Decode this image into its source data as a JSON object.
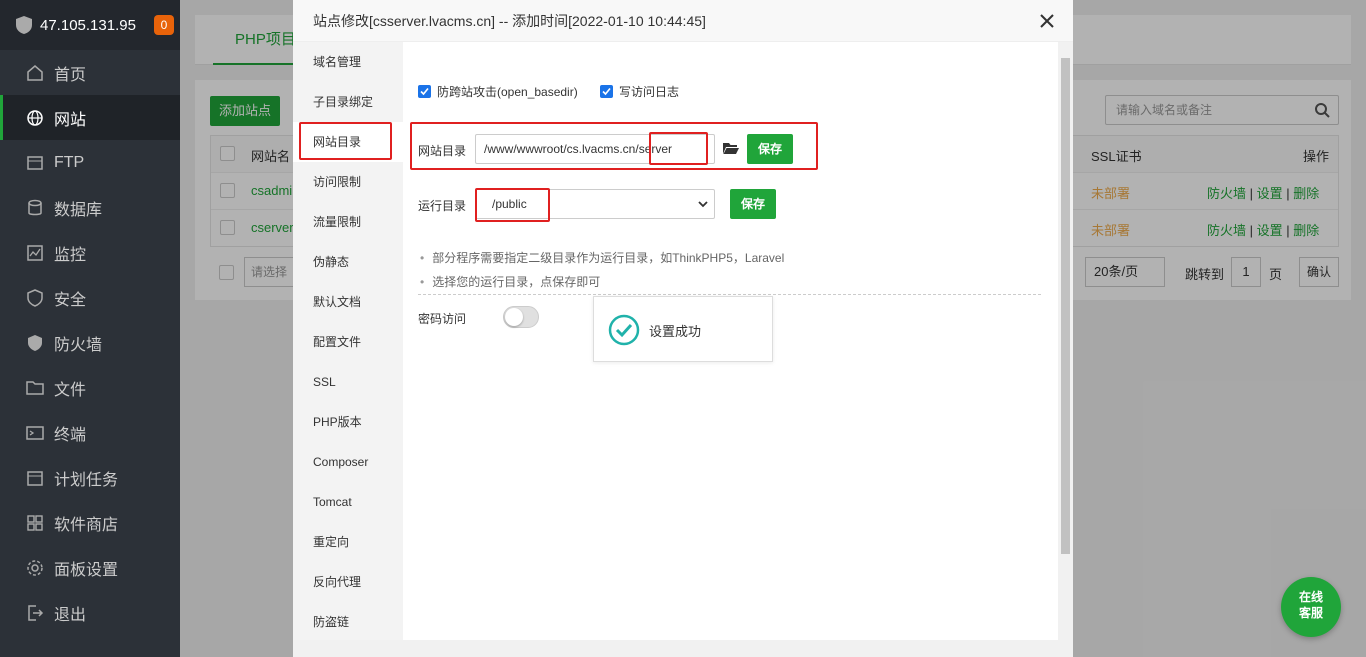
{
  "sidebar": {
    "ip": "47.105.131.95",
    "badge": "0",
    "items": [
      {
        "label": "首页",
        "icon": "home-icon"
      },
      {
        "label": "网站",
        "icon": "globe-icon"
      },
      {
        "label": "FTP",
        "icon": "ftp-icon"
      },
      {
        "label": "数据库",
        "icon": "database-icon"
      },
      {
        "label": "监控",
        "icon": "monitor-icon"
      },
      {
        "label": "安全",
        "icon": "shield-icon"
      },
      {
        "label": "防火墙",
        "icon": "firewall-icon"
      },
      {
        "label": "文件",
        "icon": "folder-icon"
      },
      {
        "label": "终端",
        "icon": "terminal-icon"
      },
      {
        "label": "计划任务",
        "icon": "calendar-icon"
      },
      {
        "label": "软件商店",
        "icon": "apps-icon"
      },
      {
        "label": "面板设置",
        "icon": "gear-icon"
      },
      {
        "label": "退出",
        "icon": "logout-icon"
      }
    ]
  },
  "main": {
    "tab": "PHP项目",
    "add_site": "添加站点",
    "search_placeholder": "请输入域名或备注",
    "col_site": "网站名",
    "col_ssl": "SSL证书",
    "col_ops": "操作",
    "rows": [
      {
        "name": "csadmi",
        "ssl": "未部署",
        "ops": [
          "防火墙",
          "设置",
          "删除"
        ]
      },
      {
        "name": "cserver",
        "ssl": "未部署",
        "ops": [
          "防火墙",
          "设置",
          "删除"
        ]
      }
    ],
    "batch_placeholder": "请选择",
    "page_size": "20条/页",
    "goto": "跳转到",
    "page": "1",
    "page_unit": "页",
    "confirm": "确认"
  },
  "modal": {
    "title": "站点修改[csserver.lvacms.cn] -- 添加时间[2022-01-10 10:44:45]",
    "side_items": [
      "域名管理",
      "子目录绑定",
      "网站目录",
      "访问限制",
      "流量限制",
      "伪静态",
      "默认文档",
      "配置文件",
      "SSL",
      "PHP版本",
      "Composer",
      "Tomcat",
      "重定向",
      "反向代理",
      "防盗链"
    ],
    "active_side": "网站目录",
    "opt_basedir": "防跨站攻击(open_basedir)",
    "opt_log": "写访问日志",
    "site_dir_label": "网站目录",
    "site_dir_value": "/www/wwwroot/cs.lvacms.cn/server",
    "run_dir_label": "运行目录",
    "run_dir_value": "/public",
    "save": "保存",
    "tips": [
      "部分程序需要指定二级目录作为运行目录，如ThinkPHP5，Laravel",
      "选择您的运行目录，点保存即可"
    ],
    "pwd_label": "密码访问",
    "pwd_enabled": false,
    "toast": "设置成功"
  },
  "chat": {
    "line1": "在线",
    "line2": "客服"
  },
  "colors": {
    "accent": "#20a53a",
    "highlight": "#e02020",
    "sidebar": "#2c3138"
  }
}
